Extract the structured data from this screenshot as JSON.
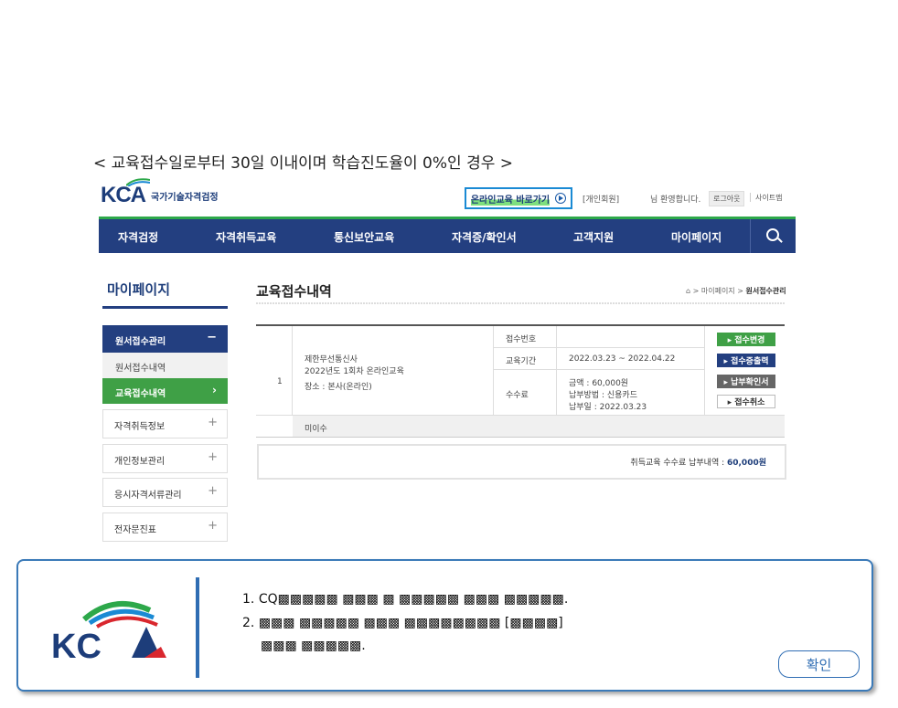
{
  "caption": "< 교육접수일로부터 30일 이내이며 학습진도율이 0%인 경우 >",
  "header": {
    "logo_text": "KCA",
    "org_name": "국가기술자격검정",
    "online_edu_label": "온라인교육 바로가기",
    "member_type": "[개인회원]",
    "welcome": "님 환영합니다.",
    "logout": "로그아웃",
    "sitemap": "사이트맵"
  },
  "nav": {
    "items": [
      "자격검정",
      "자격취득교육",
      "통신보안교육",
      "자격증/확인서",
      "고객지원",
      "마이페이지"
    ],
    "search_icon": "search-icon"
  },
  "sidebar": {
    "title": "마이페이지",
    "group": "원서접수관리",
    "group_toggle": "−",
    "sub_item": "원서접수내역",
    "active_item": "교육접수내역",
    "active_arrow": "›",
    "items": [
      "자격취득정보",
      "개인정보관리",
      "응시자격서류관리",
      "전자문진표"
    ],
    "expand": "+"
  },
  "main": {
    "title": "교육접수내역",
    "breadcrumb_mid": " > 마이페이지 > ",
    "breadcrumb_current": "원서접수관리",
    "row": {
      "no": "1",
      "company": "제한무선통신사",
      "course": "2022년도 1회차 온라인교육",
      "place": "장소 : 본사(온라인)",
      "status": "미이수",
      "label_receipt_no": "접수번호",
      "label_period": "교육기간",
      "label_fee": "수수료",
      "period_value": "2022.03.23 ~ 2022.04.22",
      "fee_amount": "금액 : 60,000원",
      "fee_method": "납부방법 : 신용카드",
      "fee_date": "납부일 : 2022.03.23"
    },
    "buttons": {
      "change": "▸ 접수변경",
      "print": "▸ 접수증출력",
      "payment": "▸ 납부확인서",
      "cancel": "▸ 접수취소"
    },
    "fee_summary_label": "취득교육 수수료 납부내역 : ",
    "fee_summary_value": "60,000원"
  },
  "dialog": {
    "line1_number": "1.",
    "line1_text": "CQ▩▩▩▩▩ ▩▩▩ ▩ ▩▩▩▩▩ ▩▩▩ ▩▩▩▩▩.",
    "line2_number": "2.",
    "line2_text": "▩▩▩ ▩▩▩▩▩ ▩▩▩ ▩▩▩▩▩▩▩▩ [▩▩▩▩]",
    "line3_text": "▩▩▩ ▩▩▩▩▩.",
    "confirm_label": "확인"
  },
  "colors": {
    "navy": "#233f80",
    "green": "#3fa046",
    "dialog_border": "#3b7ab8"
  }
}
